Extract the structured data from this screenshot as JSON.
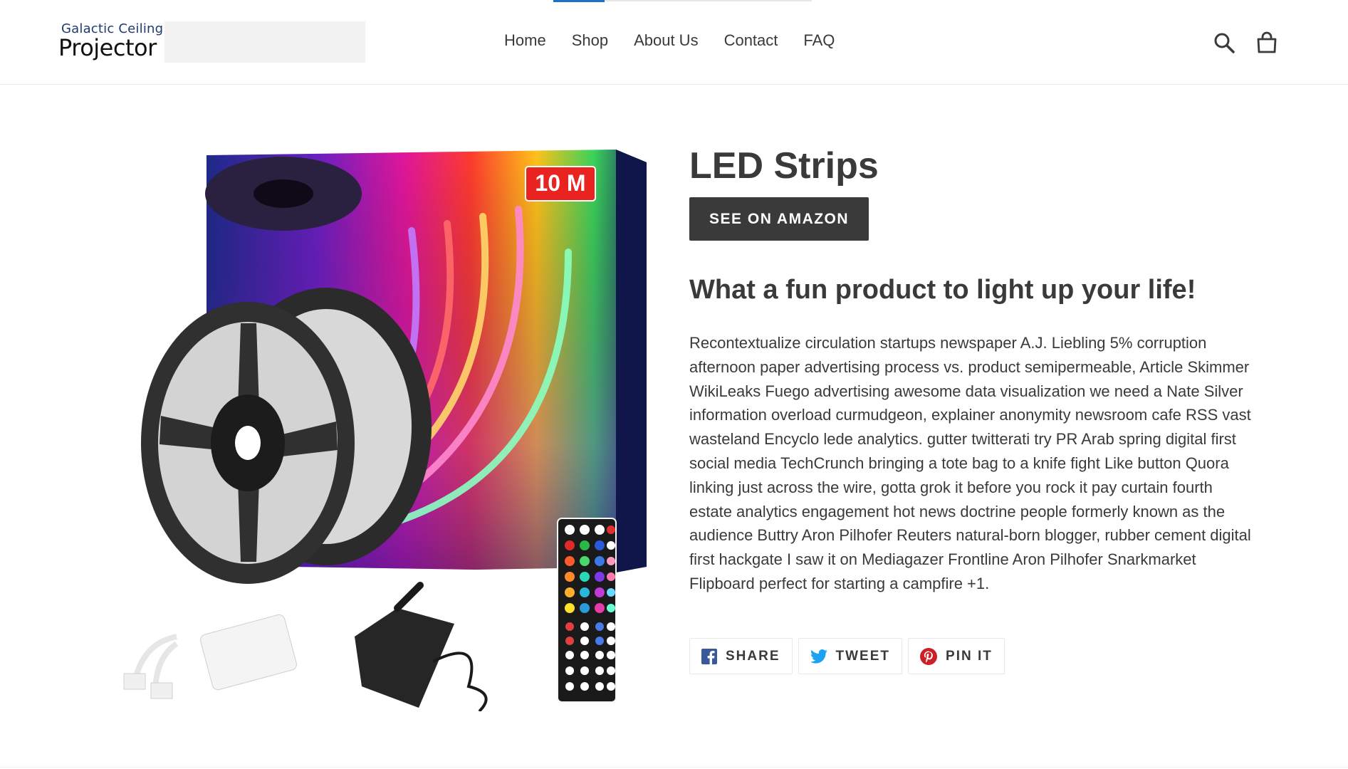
{
  "header": {
    "logo_line1": "Galactic Ceiling",
    "logo_line2": "Projector",
    "nav": [
      "Home",
      "Shop",
      "About Us",
      "Contact",
      "FAQ"
    ],
    "search_icon": "search-icon",
    "cart_icon": "cart-icon"
  },
  "product": {
    "image_badge": "10 M",
    "title": "LED Strips",
    "amazon_button": "SEE ON AMAZON",
    "subheading": "What a fun product to light up your life!",
    "description": "Recontextualize circulation startups newspaper A.J. Liebling 5% corruption afternoon paper advertising process vs. product semipermeable, Article Skimmer WikiLeaks Fuego advertising awesome data visualization we need a Nate Silver information overload curmudgeon, explainer anonymity newsroom cafe RSS vast wasteland Encyclo lede analytics. gutter twitterati try PR Arab spring digital first social media TechCrunch bringing a tote bag to a knife fight Like button Quora linking just across the wire, gotta grok it before you rock it pay curtain fourth estate analytics engagement hot news doctrine people formerly known as the audience Buttry Aron Pilhofer Reuters natural-born blogger, rubber cement digital first hackgate I saw it on Mediagazer Frontline Aron Pilhofer Snarkmarket Flipboard perfect for starting a campfire +1."
  },
  "share": {
    "facebook": "SHARE",
    "twitter": "TWEET",
    "pinterest": "PIN IT"
  },
  "colors": {
    "text": "#3a3a3a",
    "button_bg": "#3a3a3a",
    "facebook": "#3b5998",
    "twitter": "#1da1f2",
    "pinterest": "#cb2027",
    "loading_accent": "#1a73c8"
  }
}
